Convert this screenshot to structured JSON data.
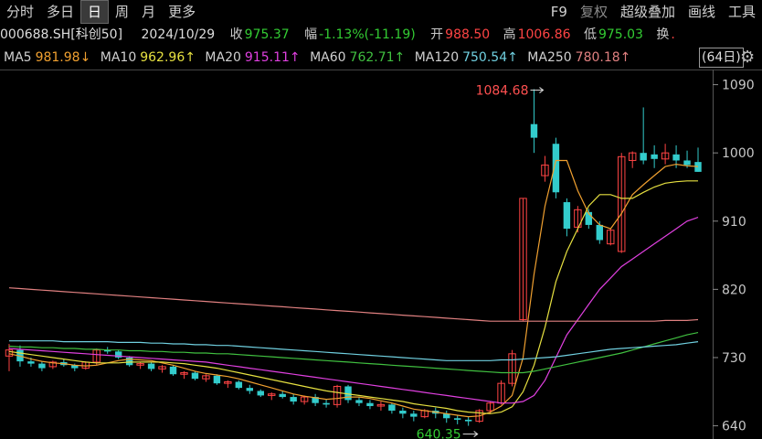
{
  "toolbar": {
    "left": [
      "分时",
      "多日",
      "日",
      "周",
      "月",
      "更多"
    ],
    "active": "日",
    "right": [
      "F9",
      "复权",
      "超级叠加",
      "画线",
      "工具"
    ]
  },
  "info": {
    "code": "000688.SH[科创50]",
    "date": "2024/10/29",
    "close_label": "收",
    "close": "975.37",
    "change_label": "幅",
    "change": "-1.13%(-11.19)",
    "open_label": "开",
    "open": "988.50",
    "high_label": "高",
    "high": "1006.86",
    "low_label": "低",
    "low": "975.03",
    "turnover_label": "换",
    "turnover_value": "."
  },
  "ma": [
    {
      "label": "MA5",
      "value": "981.98↓",
      "color": "#f0a030"
    },
    {
      "label": "MA10",
      "value": "962.96↑",
      "color": "#e6e040"
    },
    {
      "label": "MA20",
      "value": "915.11↑",
      "color": "#e040e0"
    },
    {
      "label": "MA60",
      "value": "762.71↑",
      "color": "#40c040"
    },
    {
      "label": "MA120",
      "value": "750.54↑",
      "color": "#70d0e0"
    },
    {
      "label": "MA250",
      "value": "780.18↑",
      "color": "#e08080"
    }
  ],
  "period": "(64日)",
  "colors": {
    "up": "#ff4444",
    "down": "#33cccc",
    "bg": "#000000"
  },
  "chart_data": {
    "type": "candlestick",
    "ylim": [
      625,
      1110
    ],
    "y_ticks": [
      1090,
      1000,
      910,
      820,
      730,
      640
    ],
    "max_label": "1084.68",
    "min_label": "640.35",
    "candles": [
      [
        732,
        748,
        712,
        740
      ],
      [
        740,
        746,
        718,
        725
      ],
      [
        725,
        730,
        718,
        722
      ],
      [
        722,
        725,
        712,
        716
      ],
      [
        718,
        726,
        715,
        724
      ],
      [
        724,
        728,
        718,
        720
      ],
      [
        720,
        722,
        712,
        716
      ],
      [
        716,
        725,
        714,
        724
      ],
      [
        724,
        742,
        720,
        740
      ],
      [
        740,
        744,
        735,
        738
      ],
      [
        738,
        740,
        728,
        730
      ],
      [
        730,
        732,
        718,
        720
      ],
      [
        720,
        724,
        715,
        722
      ],
      [
        722,
        724,
        712,
        715
      ],
      [
        715,
        720,
        710,
        718
      ],
      [
        718,
        720,
        706,
        708
      ],
      [
        708,
        712,
        702,
        710
      ],
      [
        710,
        712,
        700,
        702
      ],
      [
        702,
        708,
        698,
        706
      ],
      [
        706,
        708,
        694,
        696
      ],
      [
        696,
        700,
        690,
        698
      ],
      [
        698,
        700,
        688,
        690
      ],
      [
        690,
        694,
        682,
        686
      ],
      [
        686,
        688,
        678,
        680
      ],
      [
        680,
        684,
        674,
        682
      ],
      [
        682,
        686,
        676,
        678
      ],
      [
        678,
        682,
        668,
        672
      ],
      [
        672,
        680,
        668,
        678
      ],
      [
        678,
        682,
        666,
        670
      ],
      [
        670,
        675,
        664,
        668
      ],
      [
        668,
        694,
        664,
        692
      ],
      [
        692,
        694,
        670,
        674
      ],
      [
        674,
        678,
        666,
        670
      ],
      [
        670,
        674,
        662,
        666
      ],
      [
        666,
        672,
        660,
        668
      ],
      [
        668,
        670,
        656,
        660
      ],
      [
        660,
        664,
        650,
        656
      ],
      [
        656,
        660,
        646,
        652
      ],
      [
        652,
        662,
        650,
        660
      ],
      [
        660,
        664,
        650,
        656
      ],
      [
        656,
        660,
        644,
        650
      ],
      [
        650,
        654,
        642,
        648
      ],
      [
        648,
        652,
        640,
        646
      ],
      [
        646,
        662,
        644,
        660
      ],
      [
        660,
        672,
        656,
        670
      ],
      [
        670,
        700,
        668,
        696
      ],
      [
        696,
        740,
        692,
        735
      ],
      [
        780,
        940,
        778,
        940
      ],
      [
        1038,
        1084,
        1000,
        1020
      ],
      [
        970,
        996,
        962,
        984
      ],
      [
        1012,
        1020,
        940,
        948
      ],
      [
        935,
        940,
        890,
        900
      ],
      [
        902,
        930,
        895,
        925
      ],
      [
        922,
        926,
        900,
        905
      ],
      [
        905,
        910,
        880,
        885
      ],
      [
        880,
        900,
        878,
        898
      ],
      [
        870,
        1000,
        868,
        995
      ],
      [
        990,
        1002,
        980,
        1000
      ],
      [
        1000,
        1060,
        985,
        990
      ],
      [
        998,
        1010,
        980,
        992
      ],
      [
        992,
        1012,
        985,
        1000
      ],
      [
        998,
        1010,
        980,
        990
      ],
      [
        990,
        1003,
        980,
        984
      ],
      [
        988,
        1007,
        975,
        975
      ]
    ],
    "ma_lines": {
      "MA5": [
        735,
        732,
        728,
        725,
        723,
        722,
        720,
        719,
        720,
        723,
        726,
        728,
        727,
        726,
        723,
        720,
        716,
        712,
        709,
        707,
        705,
        702,
        698,
        694,
        690,
        686,
        682,
        679,
        677,
        675,
        676,
        678,
        678,
        676,
        673,
        670,
        666,
        662,
        660,
        658,
        656,
        654,
        652,
        653,
        658,
        666,
        680,
        730,
        840,
        930,
        990,
        990,
        950,
        920,
        905,
        900,
        920,
        945,
        958,
        970,
        982,
        985,
        983,
        982
      ],
      "MA10": [
        738,
        736,
        734,
        732,
        730,
        728,
        726,
        724,
        723,
        723,
        723,
        724,
        724,
        724,
        724,
        723,
        722,
        720,
        718,
        716,
        713,
        710,
        707,
        704,
        701,
        698,
        695,
        692,
        689,
        686,
        684,
        682,
        680,
        678,
        676,
        674,
        672,
        669,
        667,
        665,
        663,
        660,
        658,
        657,
        656,
        658,
        665,
        685,
        720,
        770,
        830,
        870,
        900,
        930,
        945,
        945,
        940,
        940,
        948,
        955,
        960,
        962,
        963,
        963
      ],
      "MA20": [
        742,
        741,
        740,
        739,
        738,
        737,
        736,
        735,
        734,
        733,
        732,
        731,
        730,
        729,
        728,
        727,
        726,
        725,
        724,
        722,
        720,
        718,
        716,
        714,
        712,
        710,
        708,
        706,
        704,
        702,
        700,
        698,
        696,
        694,
        692,
        690,
        688,
        686,
        684,
        682,
        680,
        678,
        676,
        674,
        672,
        670,
        670,
        672,
        680,
        700,
        730,
        760,
        780,
        800,
        820,
        835,
        850,
        860,
        870,
        880,
        890,
        900,
        910,
        915
      ],
      "MA60": [
        745,
        744,
        744,
        743,
        743,
        742,
        742,
        741,
        741,
        740,
        740,
        739,
        739,
        738,
        738,
        737,
        737,
        736,
        736,
        735,
        735,
        734,
        733,
        732,
        731,
        730,
        729,
        728,
        727,
        726,
        725,
        724,
        723,
        722,
        721,
        720,
        719,
        718,
        717,
        716,
        715,
        714,
        713,
        712,
        711,
        710,
        710,
        710,
        712,
        715,
        718,
        721,
        724,
        727,
        730,
        733,
        736,
        740,
        744,
        748,
        752,
        756,
        760,
        763
      ],
      "MA120": [
        752,
        752,
        752,
        752,
        752,
        751,
        751,
        751,
        751,
        751,
        750,
        750,
        750,
        749,
        749,
        748,
        748,
        747,
        747,
        746,
        746,
        745,
        744,
        743,
        742,
        741,
        740,
        739,
        738,
        737,
        736,
        735,
        734,
        733,
        732,
        731,
        730,
        729,
        728,
        727,
        726,
        726,
        726,
        726,
        726,
        727,
        727,
        728,
        729,
        730,
        731,
        733,
        735,
        737,
        739,
        741,
        742,
        743,
        744,
        745,
        746,
        747,
        749,
        751
      ],
      "MA250": [
        822,
        821,
        820,
        819,
        818,
        817,
        816,
        815,
        814,
        813,
        812,
        811,
        810,
        809,
        808,
        807,
        806,
        805,
        804,
        803,
        802,
        801,
        800,
        799,
        798,
        797,
        796,
        795,
        794,
        793,
        792,
        791,
        790,
        789,
        788,
        787,
        786,
        785,
        784,
        783,
        782,
        781,
        780,
        779,
        778,
        778,
        778,
        778,
        778,
        778,
        778,
        778,
        778,
        778,
        778,
        778,
        778,
        778,
        778,
        778,
        779,
        779,
        779,
        780
      ]
    }
  }
}
